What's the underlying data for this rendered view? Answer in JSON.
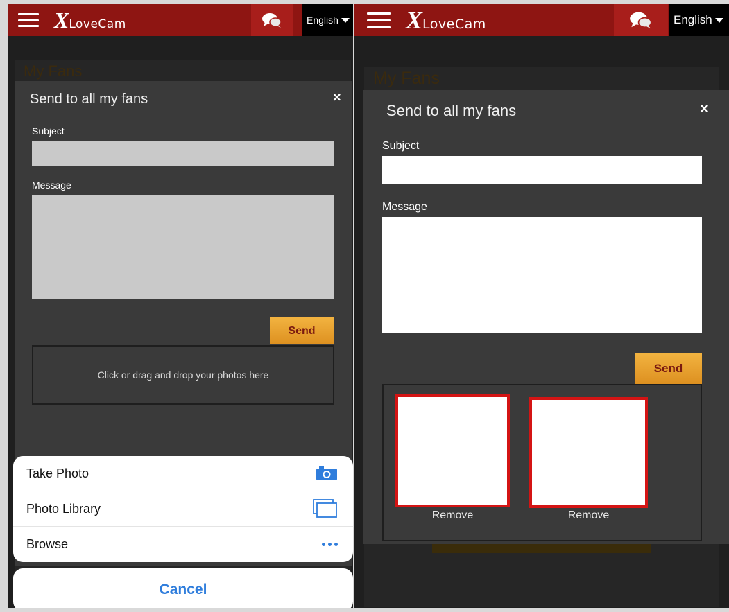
{
  "header": {
    "logo_x": "X",
    "logo_word": "LoveCam",
    "language": "English",
    "icons": {
      "menu": "hamburger-icon",
      "chat": "chat-bubbles-icon",
      "dropdown": "caret-down-icon"
    }
  },
  "page": {
    "title": "My Fans"
  },
  "modal": {
    "title": "Send to all my fans",
    "close": "×",
    "subject_label": "Subject",
    "subject_value": "",
    "message_label": "Message",
    "message_value": "",
    "send_label": "Send",
    "dropzone_text": "Click or drag and drop your photos here"
  },
  "photos": [
    {
      "remove_label": "Remove"
    },
    {
      "remove_label": "Remove"
    }
  ],
  "action_sheet": {
    "items": [
      {
        "label": "Take Photo",
        "icon": "camera-icon"
      },
      {
        "label": "Photo Library",
        "icon": "photo-library-icon"
      },
      {
        "label": "Browse",
        "icon": "more-dots-icon"
      }
    ],
    "cancel_label": "Cancel"
  },
  "colors": {
    "header_bg": "#8e1512",
    "send_button": "#f0a830",
    "thumb_border": "#d41414",
    "ios_blue": "#2f7ddc"
  }
}
